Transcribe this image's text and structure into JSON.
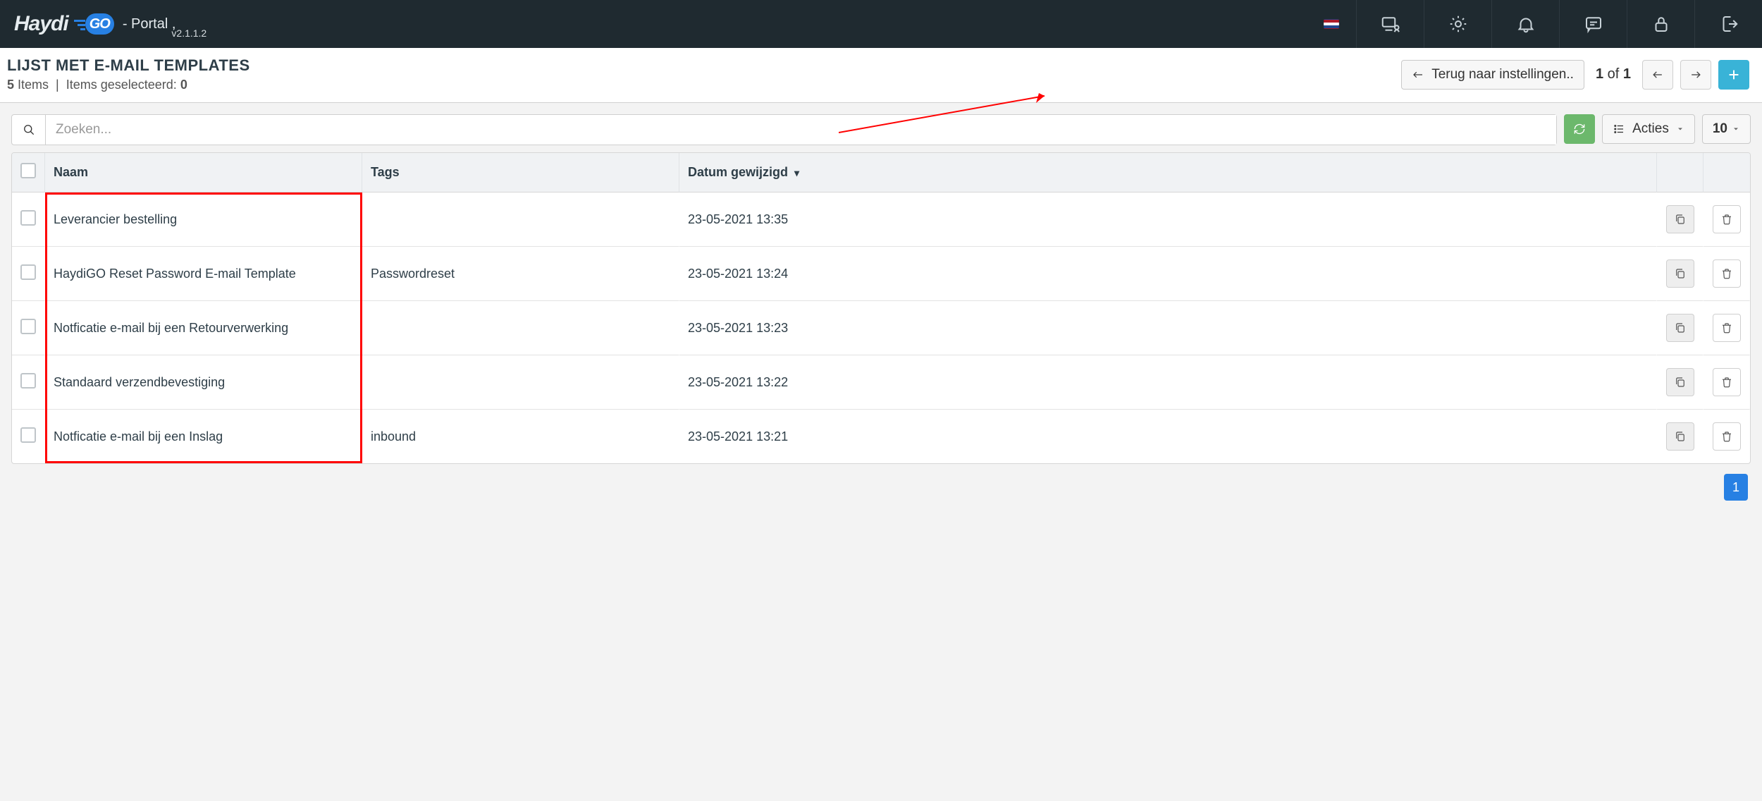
{
  "header": {
    "portal_label": "- Portal ,",
    "version": "v2.1.1.2"
  },
  "page": {
    "title": "LIJST MET E-MAIL TEMPLATES",
    "item_count_num": "5",
    "item_count_word": "Items",
    "selected_label": "Items geselecteerd:",
    "selected_count": "0",
    "back_btn": "Terug naar instellingen..",
    "pager_text_a": "1",
    "pager_text_of": "of",
    "pager_text_b": "1"
  },
  "toolbar": {
    "search_placeholder": "Zoeken...",
    "actions_label": "Acties",
    "page_size": "10"
  },
  "table": {
    "col_naam": "Naam",
    "col_tags": "Tags",
    "col_date": "Datum gewijzigd",
    "rows": [
      {
        "naam": "Leverancier bestelling",
        "tags": "",
        "date": "23-05-2021 13:35"
      },
      {
        "naam": "HaydiGO Reset Password E-mail Template",
        "tags": "Passwordreset",
        "date": "23-05-2021 13:24"
      },
      {
        "naam": "Notficatie e-mail bij een Retourverwerking",
        "tags": "",
        "date": "23-05-2021 13:23"
      },
      {
        "naam": "Standaard verzendbevestiging",
        "tags": "",
        "date": "23-05-2021 13:22"
      },
      {
        "naam": "Notficatie e-mail bij een Inslag",
        "tags": "inbound",
        "date": "23-05-2021 13:21"
      }
    ]
  },
  "pagination": {
    "current": "1"
  }
}
